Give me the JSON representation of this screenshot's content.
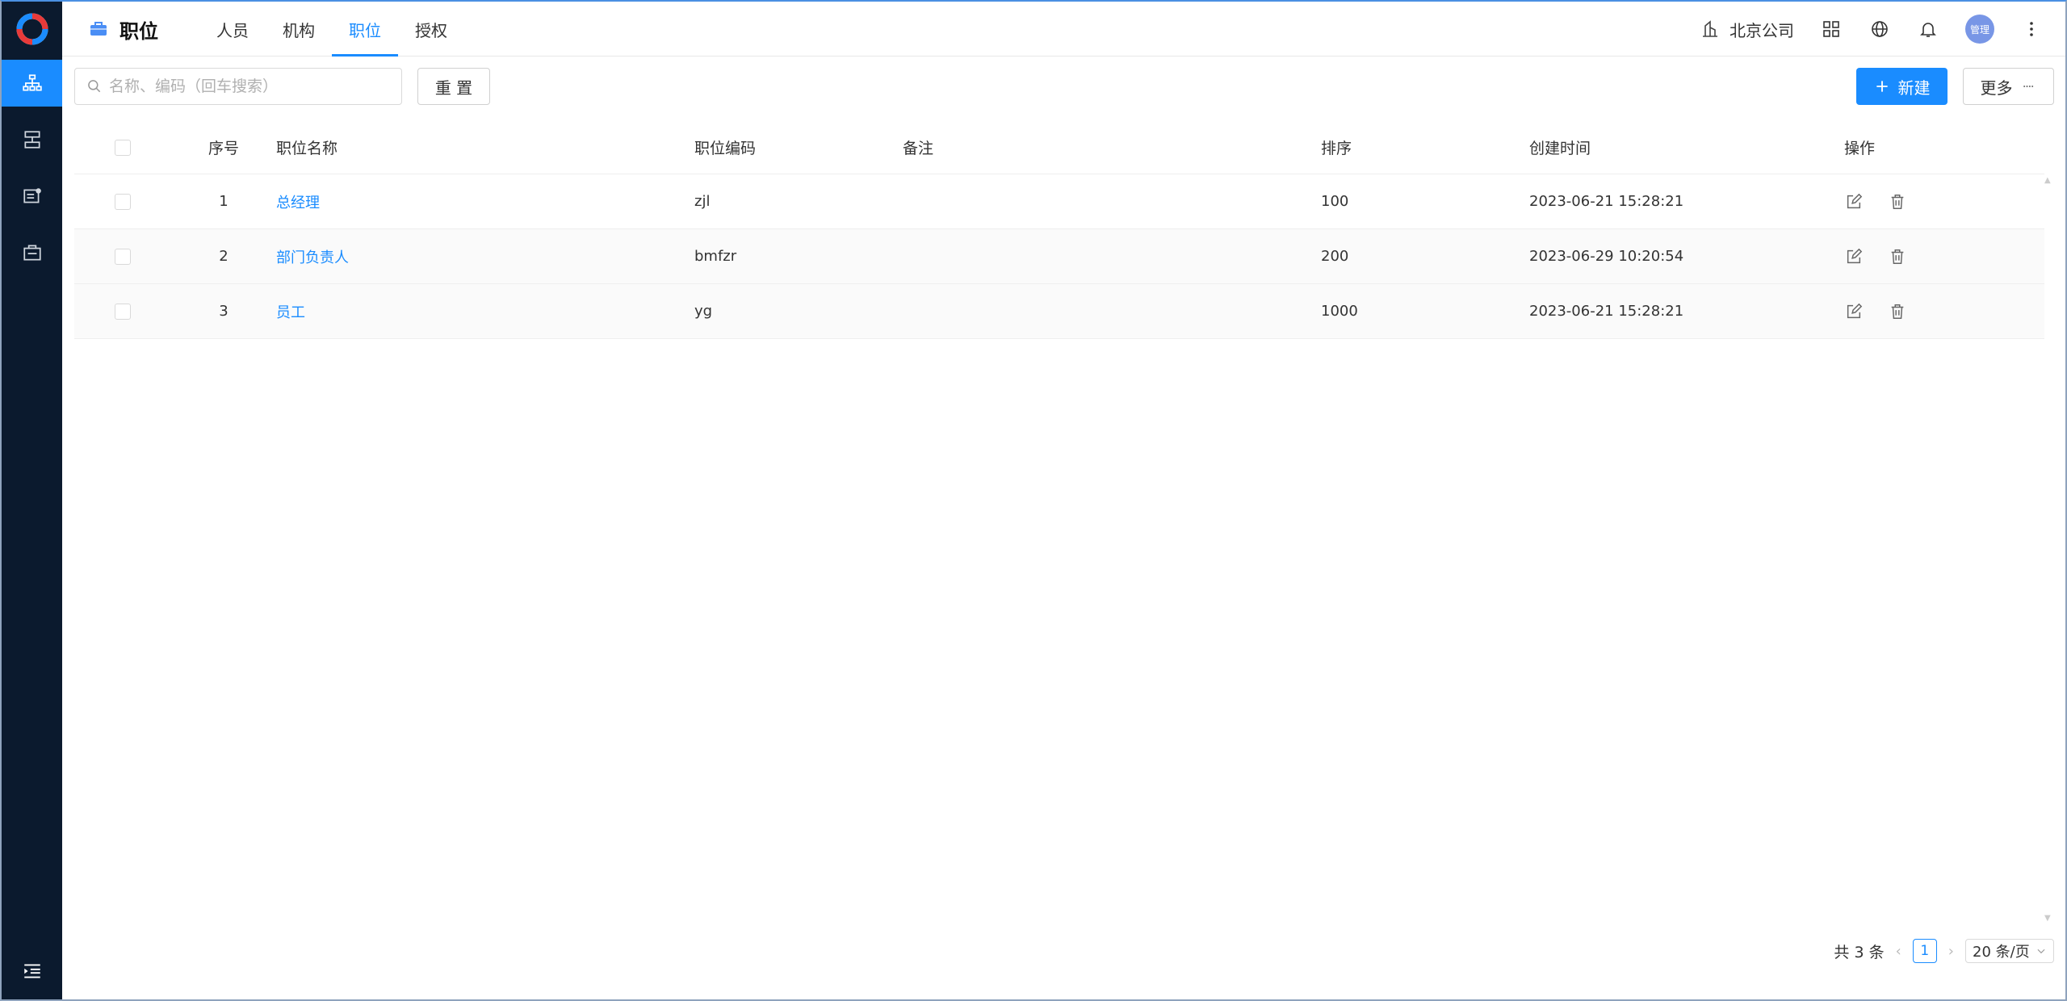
{
  "header": {
    "module_title": "职位",
    "tabs": [
      {
        "label": "人员",
        "active": false
      },
      {
        "label": "机构",
        "active": false
      },
      {
        "label": "职位",
        "active": true
      },
      {
        "label": "授权",
        "active": false
      }
    ],
    "company": "北京公司",
    "avatar_text": "管理"
  },
  "sidebar": {
    "items": [
      {
        "icon": "org-tree-icon",
        "active": true
      },
      {
        "icon": "server-icon",
        "active": false
      },
      {
        "icon": "user-card-icon",
        "active": false
      },
      {
        "icon": "briefcase-icon",
        "active": false
      }
    ]
  },
  "toolbar": {
    "search_placeholder": "名称、编码（回车搜索）",
    "reset_label": "重 置",
    "new_label": "新建",
    "more_label": "更多"
  },
  "table": {
    "columns": {
      "index": "序号",
      "name": "职位名称",
      "code": "职位编码",
      "note": "备注",
      "sort": "排序",
      "created": "创建时间",
      "ops": "操作"
    },
    "rows": [
      {
        "index": "1",
        "name": "总经理",
        "code": "zjl",
        "note": "",
        "sort": "100",
        "created": "2023-06-21 15:28:21"
      },
      {
        "index": "2",
        "name": "部门负责人",
        "code": "bmfzr",
        "note": "",
        "sort": "200",
        "created": "2023-06-29 10:20:54"
      },
      {
        "index": "3",
        "name": "员工",
        "code": "yg",
        "note": "",
        "sort": "1000",
        "created": "2023-06-21 15:28:21"
      }
    ]
  },
  "pagination": {
    "total_text": "共 3 条",
    "current_page": "1",
    "page_size": "20 条/页"
  },
  "colors": {
    "accent": "#1a8cff",
    "sidebar_bg": "#0b1a2e"
  }
}
